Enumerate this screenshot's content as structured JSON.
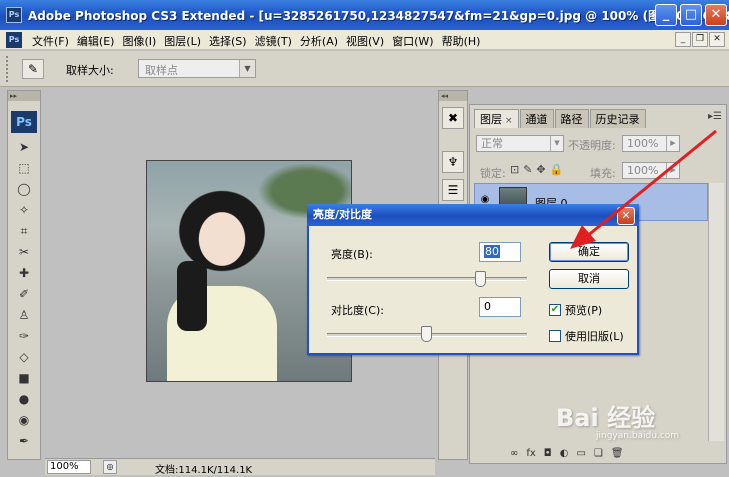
{
  "window": {
    "app_icon": "Ps",
    "title": "Adobe Photoshop CS3 Extended - [u=3285261750,1234827547&fm=21&gp=0.jpg @ 100% (图层 0, RGB/8#)]",
    "minimize": "_",
    "maximize": "□",
    "close": "✕"
  },
  "menubar": {
    "app_icon": "Ps",
    "items": [
      "文件(F)",
      "编辑(E)",
      "图像(I)",
      "图层(L)",
      "选择(S)",
      "滤镜(T)",
      "分析(A)",
      "视图(V)",
      "窗口(W)",
      "帮助(H)"
    ],
    "mdi_min": "_",
    "mdi_restore": "❐",
    "mdi_close": "✕"
  },
  "options": {
    "tool_icon": "eyedropper-icon",
    "sample_size_label": "取样大小:",
    "sample_size_value": "取样点"
  },
  "toolbox": {
    "logo": "Ps",
    "tools": [
      "move-tool-icon",
      "marquee-tool-icon",
      "lasso-tool-icon",
      "magic-wand-icon",
      "crop-icon",
      "slice-icon",
      "healing-brush-icon",
      "brush-icon",
      "stamp-icon",
      "history-brush-icon",
      "eraser-icon",
      "gradient-icon",
      "blur-icon",
      "dodge-icon",
      "pen-icon"
    ]
  },
  "status": {
    "zoom": "100%",
    "doc_info": "文档:114.1K/114.1K"
  },
  "layers_panel": {
    "tabs": [
      {
        "label": "图层",
        "active": true
      },
      {
        "label": "通道",
        "active": false
      },
      {
        "label": "路径",
        "active": false
      },
      {
        "label": "历史记录",
        "active": false
      }
    ],
    "tab_close": "×",
    "blend_mode": "正常",
    "opacity_label": "不透明度:",
    "opacity_value": "100%",
    "lock_label": "锁定:",
    "fill_label": "填充:",
    "fill_value": "100%",
    "layer_name": "图层 0",
    "bottom_icons": [
      "link-icon",
      "fx-icon",
      "mask-icon",
      "adjustment-icon",
      "group-icon",
      "new-layer-icon",
      "trash-icon"
    ]
  },
  "dialog": {
    "title": "亮度/对比度",
    "close": "✕",
    "brightness_label": "亮度(B):",
    "brightness_value": "80",
    "contrast_label": "对比度(C):",
    "contrast_value": "0",
    "ok_label": "确定",
    "cancel_label": "取消",
    "preview_label": "预览(P)",
    "preview_checked": true,
    "legacy_label": "使用旧版(L)",
    "legacy_checked": false,
    "brightness_slider_fraction": 0.77,
    "contrast_slider_fraction": 0.5
  },
  "annotation": {
    "arrow_color": "#e02020"
  },
  "watermark": {
    "brand": "Bai 经验",
    "url": "jingyan.baidu.com"
  },
  "colors": {
    "title_blue": "#1f57c8",
    "panel_bg": "#d6d3c8",
    "selected_layer": "#a8bde6"
  }
}
